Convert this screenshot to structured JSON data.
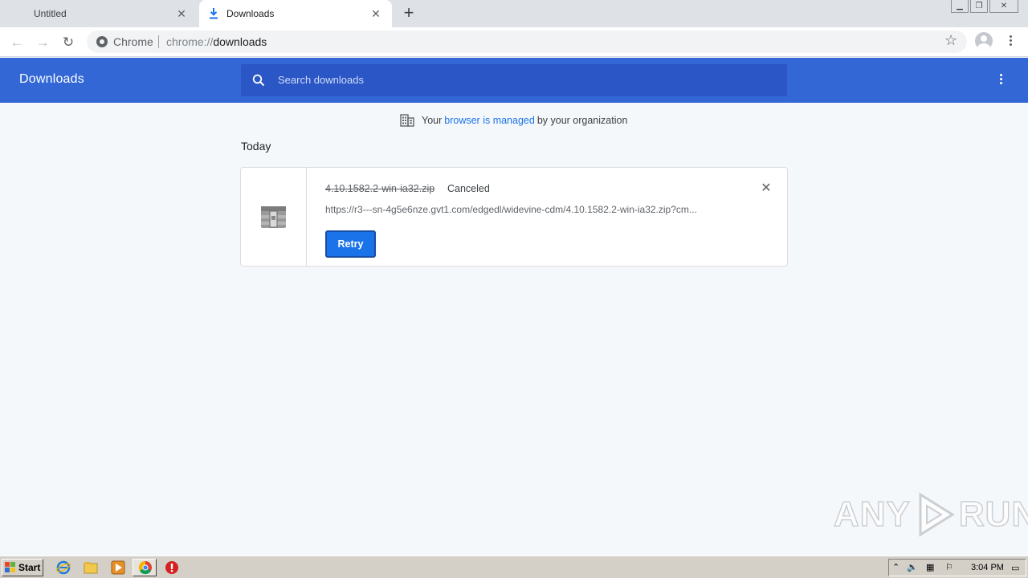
{
  "browser": {
    "tabs": [
      {
        "title": "Untitled",
        "active": false
      },
      {
        "title": "Downloads",
        "active": true
      }
    ],
    "omnibox": {
      "site_name": "Chrome",
      "url_scheme": "chrome://",
      "url_path": "downloads"
    }
  },
  "downloads": {
    "header_title": "Downloads",
    "search_placeholder": "Search downloads",
    "managed_notice": {
      "prefix": "Your",
      "link": "browser is managed",
      "suffix": "by your organization"
    },
    "sections": [
      {
        "date_label": "Today",
        "items": [
          {
            "file_name": "4.10.1582.2-win-ia32.zip",
            "status": "Canceled",
            "url": "https://r3---sn-4g5e6nze.gvt1.com/edgedl/widevine-cdm/4.10.1582.2-win-ia32.zip?cm...",
            "action_label": "Retry"
          }
        ]
      }
    ]
  },
  "watermark": {
    "left": "ANY",
    "right": "RUN"
  },
  "taskbar": {
    "start_label": "Start",
    "clock": "3:04 PM"
  },
  "colors": {
    "header_bg": "#3367d6",
    "search_bg": "#2a56c6",
    "retry_bg": "#1a73e8",
    "link": "#1a73e8"
  }
}
